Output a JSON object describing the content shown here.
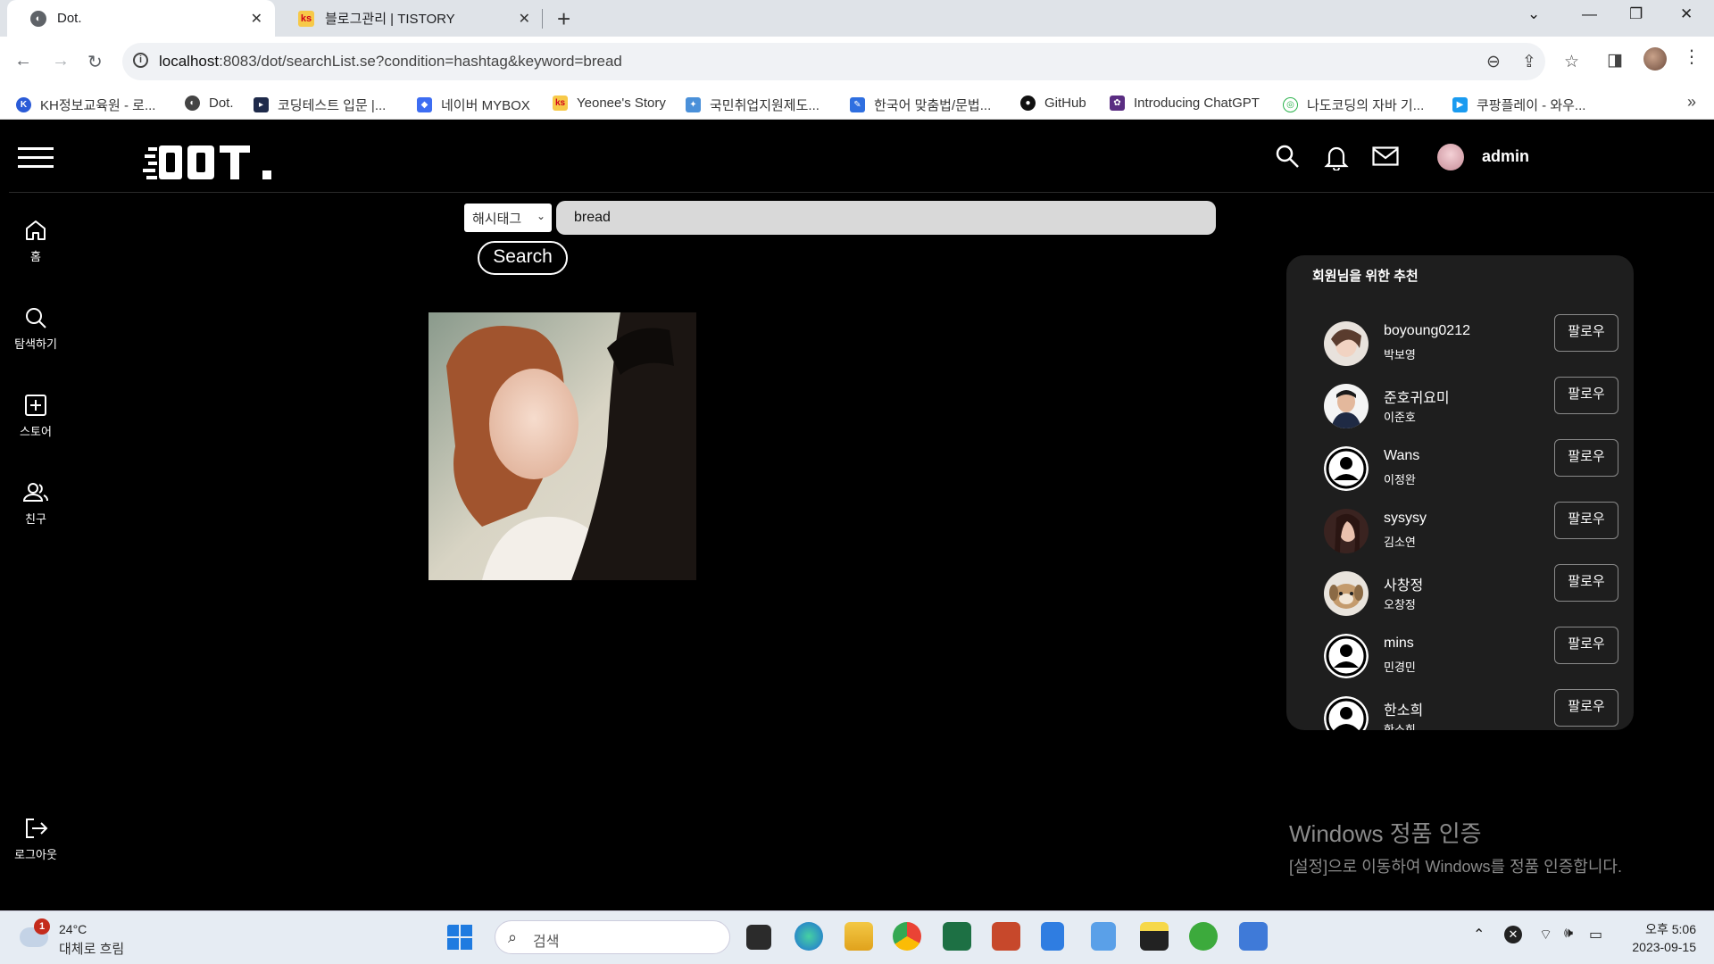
{
  "browser": {
    "tabs": [
      {
        "title": "Dot.",
        "active": true
      },
      {
        "title": "블로그관리 | TISTORY",
        "active": false
      }
    ],
    "url_host": "localhost",
    "url_rest": ":8083/dot/searchList.se?condition=hashtag&keyword=bread",
    "bookmarks": [
      {
        "label": "KH정보교육원 - 로..."
      },
      {
        "label": "Dot."
      },
      {
        "label": "코딩테스트 입문 |..."
      },
      {
        "label": "네이버 MYBOX"
      },
      {
        "label": "Yeonee's Story"
      },
      {
        "label": "국민취업지원제도..."
      },
      {
        "label": "한국어 맞춤법/문법..."
      },
      {
        "label": "GitHub"
      },
      {
        "label": "Introducing ChatGPT"
      },
      {
        "label": "나도코딩의 자바 기..."
      },
      {
        "label": "쿠팡플레이 - 와우..."
      }
    ]
  },
  "app": {
    "user": "admin",
    "nav": [
      {
        "label": "홈",
        "icon": "home-icon"
      },
      {
        "label": "탐색하기",
        "icon": "search-icon"
      },
      {
        "label": "스토어",
        "icon": "plus-square-icon"
      },
      {
        "label": "친구",
        "icon": "friends-icon"
      }
    ],
    "logout_label": "로그아웃",
    "search": {
      "condition": "해시태그",
      "keyword": "bread",
      "button": "Search"
    },
    "recommend": {
      "title": "회원님을 위한 추천",
      "follow_label": "팔로우",
      "users": [
        {
          "id": "boyoung0212",
          "name": "박보영",
          "avatar": "photo"
        },
        {
          "id": "준호귀요미",
          "name": "이준호",
          "avatar": "photo"
        },
        {
          "id": "Wans",
          "name": "이정완",
          "avatar": "default"
        },
        {
          "id": "sysysy",
          "name": "김소연",
          "avatar": "photo"
        },
        {
          "id": "사창정",
          "name": "오창정",
          "avatar": "photo"
        },
        {
          "id": "mins",
          "name": "민경민",
          "avatar": "default"
        },
        {
          "id": "한소희",
          "name": "한소희",
          "avatar": "default"
        }
      ]
    },
    "watermark": {
      "line1": "Windows 정품 인증",
      "line2": "[설정]으로 이동하여 Windows를 정품 인증합니다."
    }
  },
  "taskbar": {
    "weather_temp": "24°C",
    "weather_desc": "대체로 흐림",
    "weather_badge": "1",
    "search_placeholder": "검색",
    "time": "오후 5:06",
    "date": "2023-09-15"
  }
}
